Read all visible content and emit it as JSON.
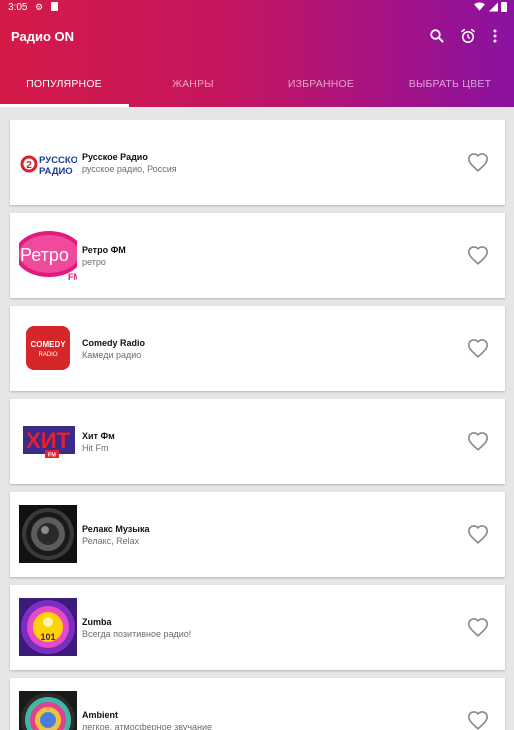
{
  "status": {
    "time": "3:05"
  },
  "appbar": {
    "title": "Радио ON"
  },
  "tabs": [
    {
      "label": "ПОПУЛЯРНОЕ",
      "active": true
    },
    {
      "label": "ЖАНРЫ"
    },
    {
      "label": "ИЗБРАННОЕ"
    },
    {
      "label": "ВЫБРАТЬ ЦВЕТ"
    }
  ],
  "colors": {
    "header_start": "#d51a47",
    "header_end": "#8a12a0",
    "background": "#e6e6e6"
  },
  "stations": [
    {
      "name": "Русское Радио",
      "desc": "русское радио, Россия",
      "logo": "russkoe-radio-logo"
    },
    {
      "name": "Ретро ФМ",
      "desc": "ретро",
      "logo": "retro-fm-logo"
    },
    {
      "name": "Comedy Radio",
      "desc": "Камеди радио",
      "logo": "comedy-radio-logo"
    },
    {
      "name": "Хит Фм",
      "desc": "Hit Fm",
      "logo": "hit-fm-logo"
    },
    {
      "name": "Релакс Музыка",
      "desc": "Релакс, Relax",
      "logo": "speaker-logo"
    },
    {
      "name": "Zumba",
      "desc": "Всегда позитивное радио!",
      "logo": "zumba-101-logo"
    },
    {
      "name": "Ambient",
      "desc": "легкое, атмосферное звучание",
      "logo": "ambient-logo"
    }
  ],
  "logos": {
    "russkoe_line1": "РУССКОЕ",
    "russkoe_line2": "РАДИО",
    "retro_text": "Ретро",
    "retro_fm": "FM",
    "comedy_line1": "COMEDY",
    "comedy_line2": "RADIO",
    "hit_text": "ХИТ",
    "hit_fm": "FM",
    "zumba_num": "101"
  }
}
